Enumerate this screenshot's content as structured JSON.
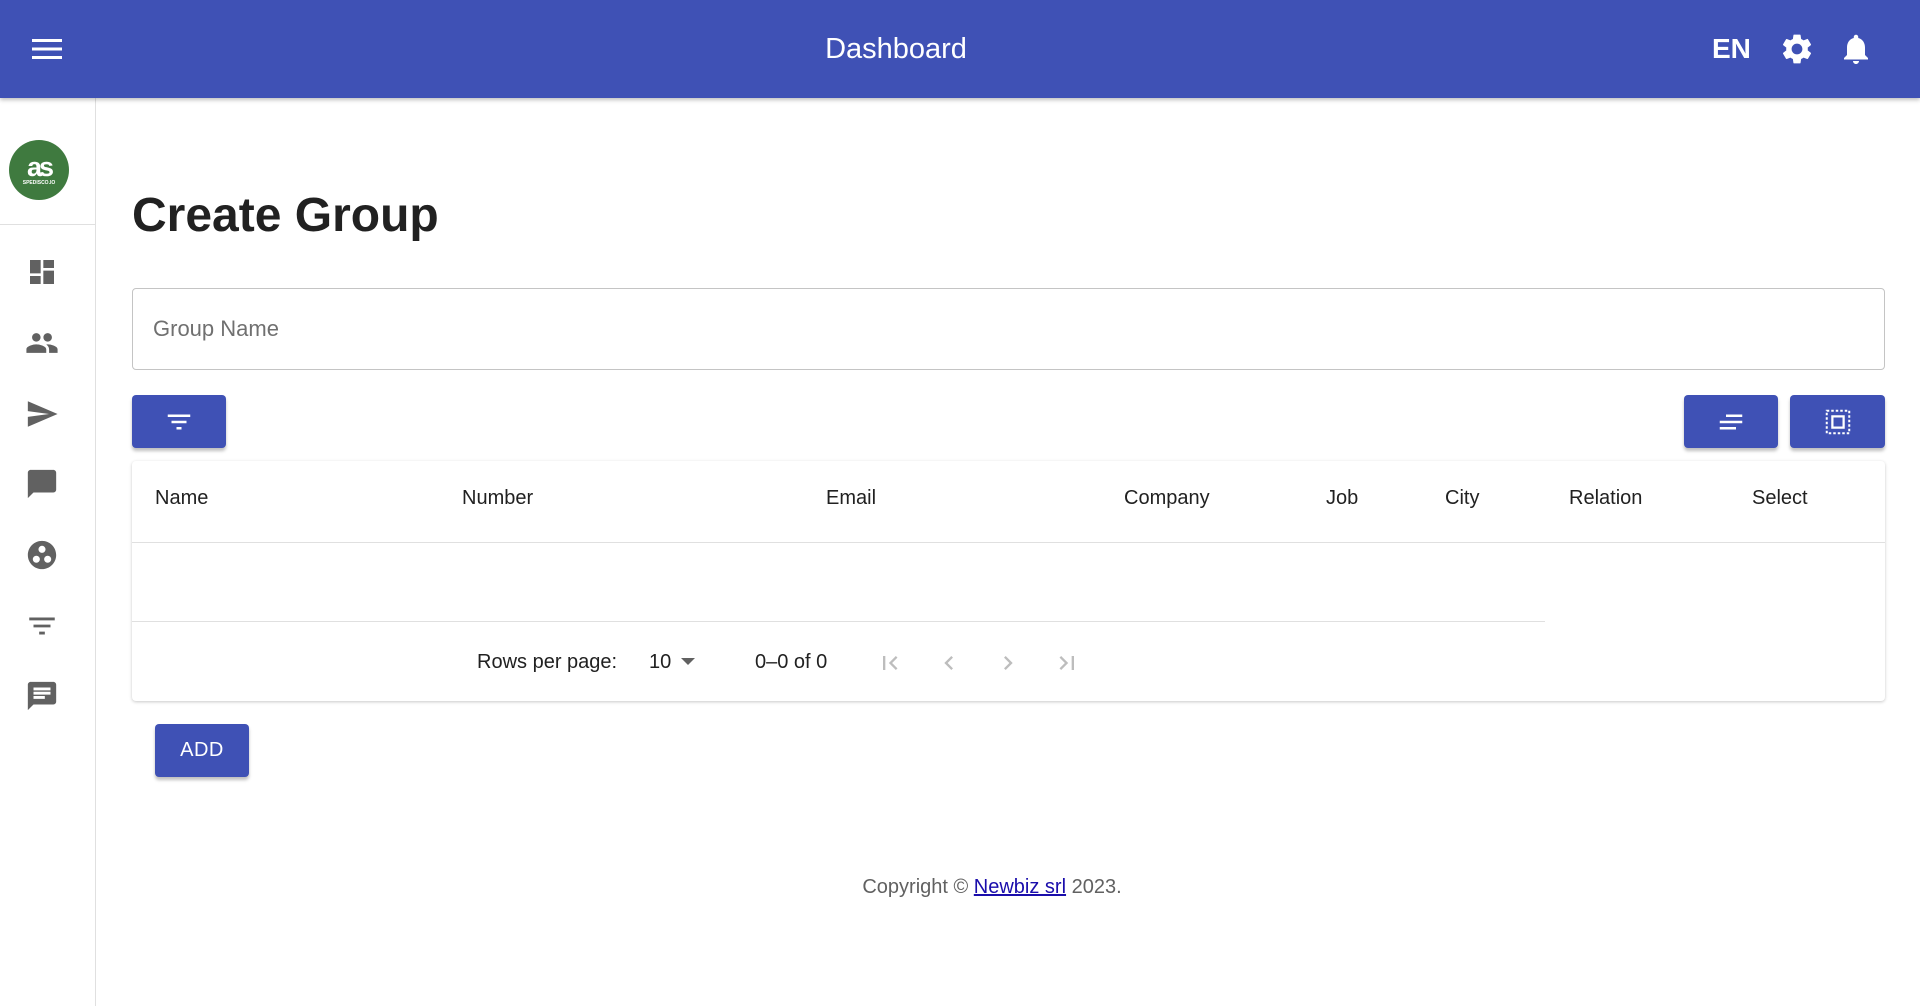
{
  "header": {
    "title": "Dashboard",
    "language": "EN",
    "menu_icon": "menu-icon",
    "settings_icon": "gear-icon",
    "notifications_icon": "bell-icon",
    "background_color": "#3f51b5"
  },
  "sidebar": {
    "logo": {
      "mark": "as",
      "caption": "SPEDISCO.IO",
      "color": "#3f7a3f"
    },
    "items": [
      {
        "icon": "dashboard-icon"
      },
      {
        "icon": "people-icon"
      },
      {
        "icon": "send-icon"
      },
      {
        "icon": "chat-bubble-icon"
      },
      {
        "icon": "group-work-icon"
      },
      {
        "icon": "filter-list-icon"
      },
      {
        "icon": "message-icon"
      }
    ]
  },
  "main": {
    "page_title": "Create Group",
    "group_name_placeholder": "Group Name",
    "group_name_value": "",
    "toolbar": {
      "filter_icon": "filter-icon",
      "sort_icon": "sort-lines-icon",
      "select_icon": "select-all-icon"
    },
    "table": {
      "columns": [
        "Name",
        "Number",
        "Email",
        "Company",
        "Job",
        "City",
        "Relation",
        "Select"
      ],
      "rows": [],
      "pagination": {
        "rows_per_page_label": "Rows per page:",
        "rows_per_page": "10",
        "range": "0–0 of 0"
      }
    },
    "add_label": "ADD"
  },
  "footer": {
    "prefix": "Copyright © ",
    "link_text": "Newbiz srl",
    "suffix": " 2023."
  }
}
